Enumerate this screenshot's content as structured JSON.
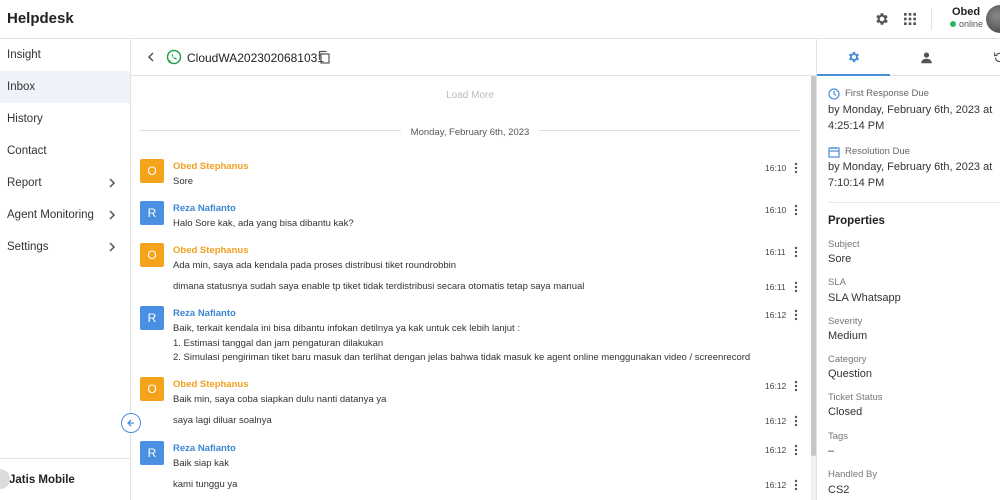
{
  "app": {
    "title": "Helpdesk"
  },
  "topbar": {
    "user_name": "Obed",
    "user_status": "online",
    "icons": [
      "gear-icon",
      "apps-grid-icon"
    ]
  },
  "sidebar": {
    "items": [
      {
        "label": "Insight"
      },
      {
        "label": "Inbox"
      },
      {
        "label": "History"
      },
      {
        "label": "Contact"
      },
      {
        "label": "Report"
      },
      {
        "label": "Agent Monitoring"
      },
      {
        "label": "Settings"
      }
    ],
    "footer_label": "Jatis Mobile"
  },
  "chat": {
    "ticket_id": "CloudWA2023020681031",
    "load_more": "Load More",
    "date_label": "Monday, February 6th, 2023",
    "messages": [
      {
        "initial": "O",
        "name": "Obed Stephanus",
        "lines": [
          "Sore"
        ],
        "time": "16:10"
      },
      {
        "initial": "R",
        "name": "Reza Nafianto",
        "lines": [
          "Halo Sore kak, ada yang bisa dibantu kak?"
        ],
        "time": "16:10"
      },
      {
        "initial": "O",
        "name": "Obed Stephanus",
        "lines": [
          "Ada min, saya ada kendala pada proses distribusi tiket roundrobbin"
        ],
        "time": "16:11"
      },
      {
        "initial": "",
        "name": "",
        "lines": [
          "dimana statusnya sudah saya enable tp tiket tidak terdistribusi secara otomatis tetap saya manual"
        ],
        "time": "16:11"
      },
      {
        "initial": "R",
        "name": "Reza Nafianto",
        "lines": [
          "Baik, terkait kendala ini bisa dibantu infokan detilnya ya kak untuk cek lebih lanjut :",
          "1. Estimasi tanggal dan jam pengaturan dilakukan",
          "2. Simulasi pengiriman tiket baru masuk dan terlihat dengan jelas bahwa tidak masuk ke agent online menggunakan video / screenrecord"
        ],
        "time": "16:12"
      },
      {
        "initial": "O",
        "name": "Obed Stephanus",
        "lines": [
          "Baik min, saya coba siapkan dulu nanti datanya ya"
        ],
        "time": "16:12"
      },
      {
        "initial": "",
        "name": "",
        "lines": [
          "saya lagi diluar soalnya"
        ],
        "time": "16:12"
      },
      {
        "initial": "R",
        "name": "Reza Nafianto",
        "lines": [
          "Baik siap kak"
        ],
        "time": "16:12"
      },
      {
        "initial": "",
        "name": "",
        "lines": [
          "kami tunggu ya"
        ],
        "time": "16:12"
      }
    ]
  },
  "details": {
    "first_response_label": "First Response Due",
    "first_response_value": "by Monday, February 6th, 2023 at 4:25:14 PM",
    "resolution_label": "Resolution Due",
    "resolution_value": "by Monday, February 6th, 2023 at 7:10:14 PM",
    "properties_title": "Properties",
    "properties": [
      {
        "label": "Subject",
        "value": "Sore"
      },
      {
        "label": "SLA",
        "value": "SLA Whatsapp"
      },
      {
        "label": "Severity",
        "value": "Medium"
      },
      {
        "label": "Category",
        "value": "Question"
      },
      {
        "label": "Ticket Status",
        "value": "Closed"
      },
      {
        "label": "Tags",
        "value": "–"
      },
      {
        "label": "Handled By",
        "value": "CS2"
      }
    ]
  },
  "colors": {
    "accent": "#4a90d9",
    "agent_orange": "#f5a31a",
    "agent_blue": "#4a90e2",
    "online": "#2ab36b"
  }
}
